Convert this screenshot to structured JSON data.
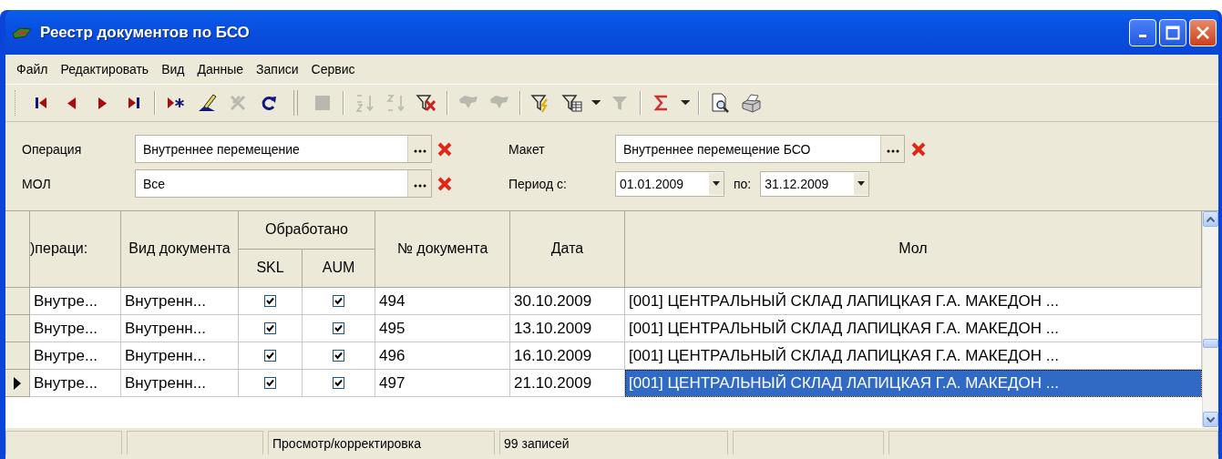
{
  "window": {
    "title": "Реестр документов по БСО"
  },
  "menu": [
    "Файл",
    "Редактировать",
    "Вид",
    "Данные",
    "Записи",
    "Сервис"
  ],
  "toolbar": [
    {
      "kind": "first",
      "disabled": false
    },
    {
      "kind": "prev",
      "disabled": false
    },
    {
      "kind": "next",
      "disabled": false
    },
    {
      "kind": "last",
      "disabled": false
    },
    {
      "kind": "sep"
    },
    {
      "kind": "insert",
      "disabled": false
    },
    {
      "kind": "edit",
      "disabled": false
    },
    {
      "kind": "cancel",
      "disabled": true
    },
    {
      "kind": "refresh",
      "disabled": false
    },
    {
      "kind": "bigsep"
    },
    {
      "kind": "stop",
      "disabled": true
    },
    {
      "kind": "sep"
    },
    {
      "kind": "sortasc",
      "disabled": true
    },
    {
      "kind": "sortdesc",
      "disabled": true
    },
    {
      "kind": "clearfilter",
      "disabled": false
    },
    {
      "kind": "sep"
    },
    {
      "kind": "cloud",
      "disabled": true
    },
    {
      "kind": "cloud",
      "disabled": true
    },
    {
      "kind": "sep"
    },
    {
      "kind": "quickfilter",
      "disabled": false
    },
    {
      "kind": "tablefilter",
      "disabled": false
    },
    {
      "kind": "caret",
      "disabled": false
    },
    {
      "kind": "funnel",
      "disabled": true
    },
    {
      "kind": "sep"
    },
    {
      "kind": "sum",
      "disabled": false
    },
    {
      "kind": "caret",
      "disabled": false
    },
    {
      "kind": "sep"
    },
    {
      "kind": "preview",
      "disabled": false
    },
    {
      "kind": "print",
      "disabled": false
    }
  ],
  "filters": {
    "operation": {
      "label": "Операция",
      "value": "Внутреннее перемещение"
    },
    "layout": {
      "label": "Макет",
      "value": "Внутреннее перемещение БСО"
    },
    "mol": {
      "label": "МОЛ",
      "value": "Все"
    },
    "period": {
      "label": "Период с:",
      "from": "01.01.2009",
      "to_label": "по:",
      "to": "31.12.2009"
    }
  },
  "table": {
    "columns": {
      "operation": ")пераци:",
      "doc_type": "Вид документа",
      "processed": "Обработано",
      "skl": "SKL",
      "aum": "AUM",
      "number": "№ документа",
      "date": "Дата",
      "mol": "Мол"
    },
    "rows": [
      {
        "operation": "Внутре...",
        "doc_type": "Внутренн...",
        "skl": true,
        "aum": true,
        "number": "494",
        "date": "30.10.2009",
        "mol": "[001] ЦЕНТРАЛЬНЫЙ СКЛАД ЛАПИЦКАЯ Г.А. МАКЕДОН ...",
        "selected": false
      },
      {
        "operation": "Внутре...",
        "doc_type": "Внутренн...",
        "skl": true,
        "aum": true,
        "number": "495",
        "date": "13.10.2009",
        "mol": "[001] ЦЕНТРАЛЬНЫЙ СКЛАД ЛАПИЦКАЯ Г.А. МАКЕДОН ...",
        "selected": false
      },
      {
        "operation": "Внутре...",
        "doc_type": "Внутренн...",
        "skl": true,
        "aum": true,
        "number": "496",
        "date": "16.10.2009",
        "mol": "[001] ЦЕНТРАЛЬНЫЙ СКЛАД ЛАПИЦКАЯ Г.А. МАКЕДОН ...",
        "selected": false
      },
      {
        "operation": "Внутре...",
        "doc_type": "Внутренн...",
        "skl": true,
        "aum": true,
        "number": "497",
        "date": "21.10.2009",
        "mol": "[001] ЦЕНТРАЛЬНЫЙ СКЛАД ЛАПИЦКАЯ Г.А. МАКЕДОН ...",
        "selected": true
      }
    ]
  },
  "status_bar": [
    {
      "kind": "blank"
    },
    {
      "kind": "blank"
    },
    {
      "kind": "text",
      "text": "Просмотр/корректировка"
    },
    {
      "kind": "text",
      "text": "99 записей"
    },
    {
      "kind": "blank"
    },
    {
      "kind": "blank"
    }
  ]
}
